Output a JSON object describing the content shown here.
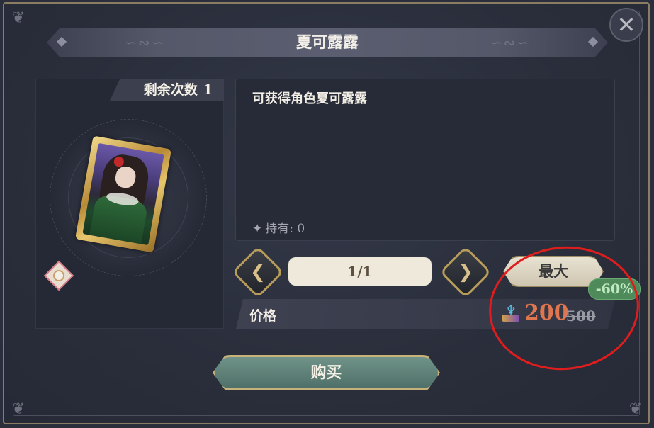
{
  "dialog": {
    "title": "夏可露露",
    "close_icon": "close-icon"
  },
  "item": {
    "remaining_label": "剩余次数",
    "remaining_count": "1",
    "description": "可获得角色夏可露露",
    "owned_label": "持有: 0"
  },
  "quantity": {
    "value": "1/1",
    "prev_icon": "chevron-left-icon",
    "next_icon": "chevron-right-icon",
    "max_label": "最大"
  },
  "price": {
    "label": "价格",
    "current": "200",
    "original": "500",
    "discount": "-60%",
    "currency_icon": "currency-icon"
  },
  "buy_label": "购买",
  "colors": {
    "price_current": "#e0764f",
    "discount_bg": "#4e8a5a",
    "annotation": "#e01d1d"
  }
}
